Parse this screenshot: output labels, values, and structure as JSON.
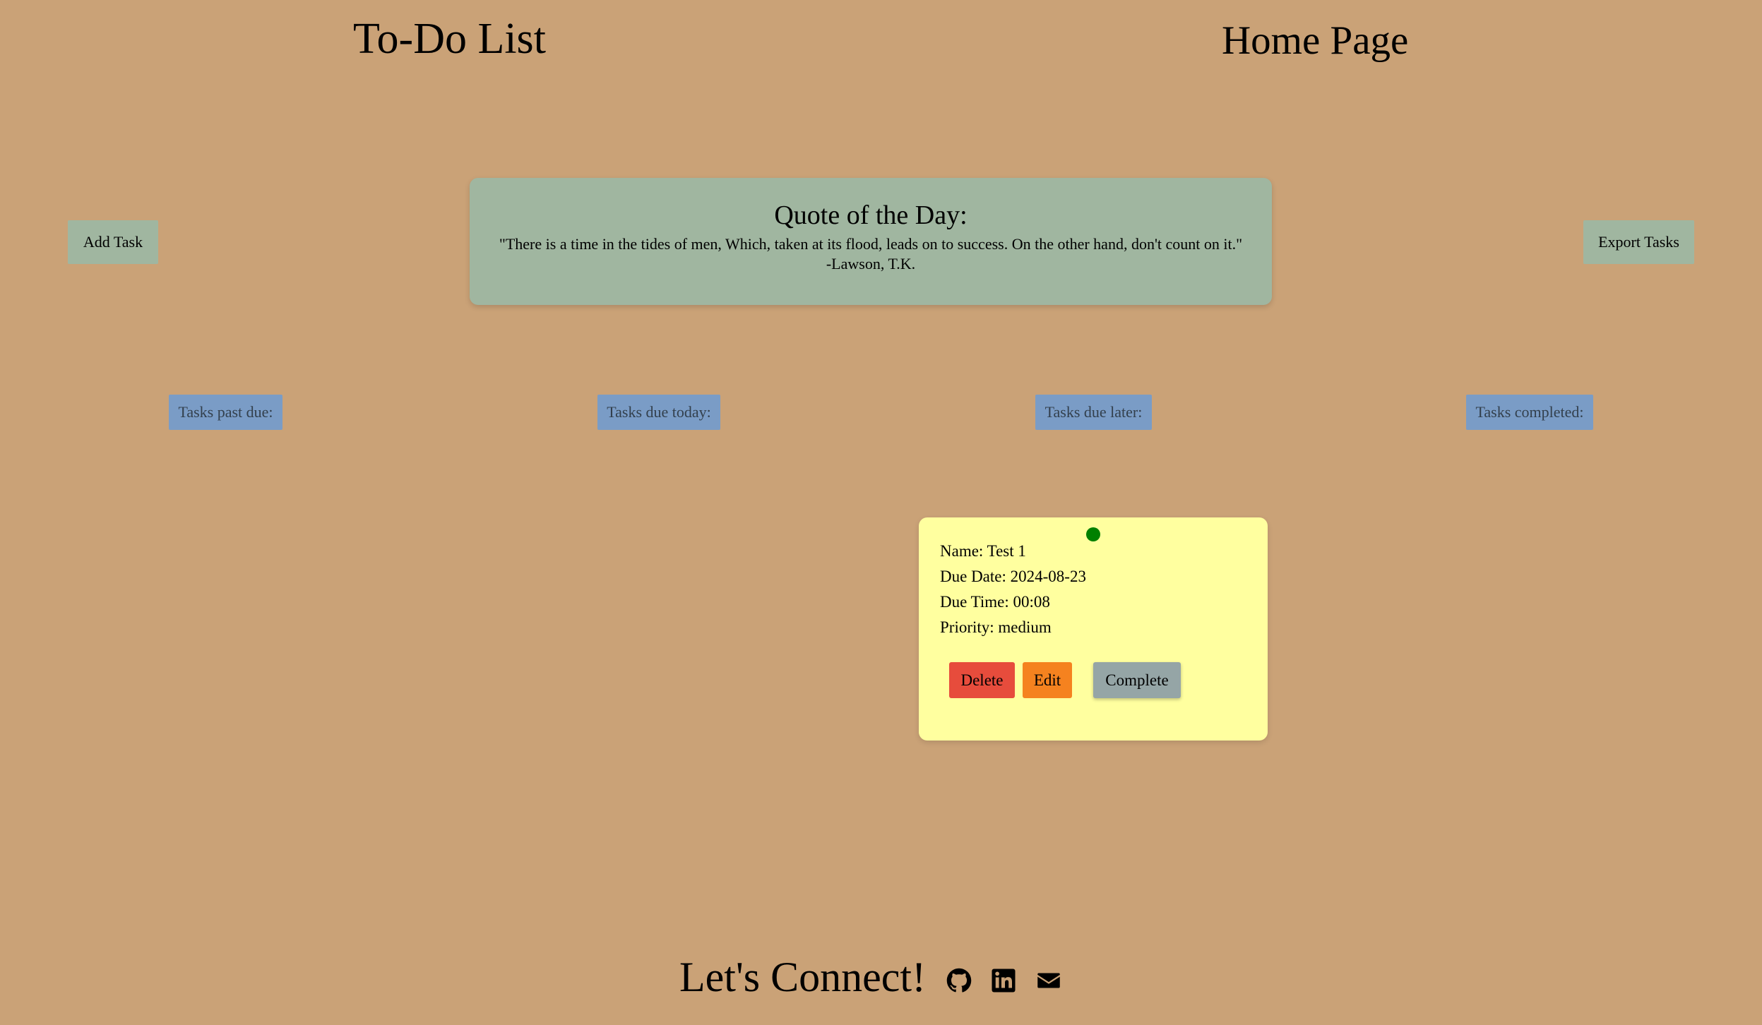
{
  "header": {
    "app_title": "To-Do List",
    "page_title": "Home Page"
  },
  "actions": {
    "add_task_label": "Add Task",
    "export_tasks_label": "Export Tasks"
  },
  "quote": {
    "heading": "Quote of the Day:",
    "text": "\"There is a time in the tides of men, Which, taken at its flood, leads on to success. On the other hand, don't count on it.\"",
    "author": "-Lawson, T.K."
  },
  "sections": {
    "past_due": "Tasks past due:",
    "due_today": "Tasks due today:",
    "due_later": "Tasks due later:",
    "completed": "Tasks completed:"
  },
  "task_card": {
    "name": "Name: Test 1",
    "due_date": "Due Date: 2024-08-23",
    "due_time": "Due Time: 00:08",
    "priority": "Priority: medium",
    "delete_label": "Delete",
    "edit_label": "Edit",
    "complete_label": "Complete"
  },
  "footer": {
    "heading": "Let's Connect!",
    "icons": [
      "github-icon",
      "linkedin-icon",
      "email-icon"
    ]
  },
  "colors": {
    "page_background": "#caa277",
    "sage_panel": "#a0b6a0",
    "section_label_blue": "#7a9cc6",
    "section_label_text": "#33404d",
    "task_card_yellow": "#ffff9f",
    "priority_dot_green": "#008000",
    "delete_red": "#e74c3c",
    "edit_orange": "#f5821f",
    "complete_gray": "#95a5a6"
  }
}
